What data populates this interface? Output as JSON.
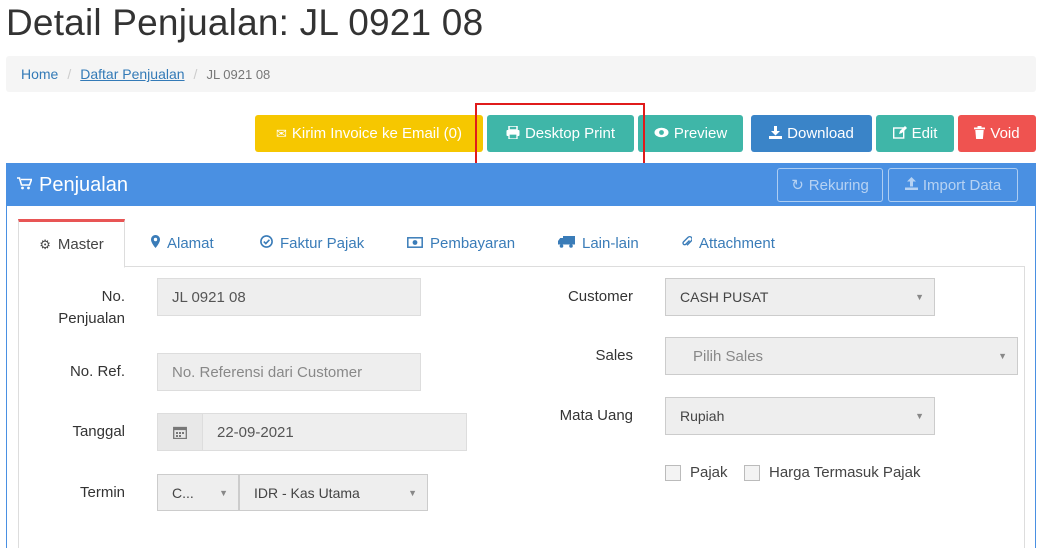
{
  "page": {
    "title": "Detail Penjualan: JL 0921 08"
  },
  "breadcrumb": {
    "home": "Home",
    "list": "Daftar Penjualan",
    "current": "JL 0921 08",
    "separator": "/"
  },
  "actions": {
    "email": "Kirim Invoice ke Email (0)",
    "print": "Desktop Print",
    "preview": "Preview",
    "download": "Download",
    "edit": "Edit",
    "void": "Void"
  },
  "panel": {
    "title": "Penjualan",
    "rekuring": "Rekuring",
    "import": "Import Data"
  },
  "tabs": [
    {
      "label": "Master",
      "icon": "gears-icon"
    },
    {
      "label": "Alamat",
      "icon": "map-marker-icon"
    },
    {
      "label": "Faktur Pajak",
      "icon": "check-circle-icon"
    },
    {
      "label": "Pembayaran",
      "icon": "money-icon"
    },
    {
      "label": "Lain-lain",
      "icon": "truck-icon"
    },
    {
      "label": "Attachment",
      "icon": "paperclip-icon"
    }
  ],
  "form": {
    "no_penjualan_label_1": "No.",
    "no_penjualan_label_2": "Penjualan",
    "no_penjualan_value": "JL 0921 08",
    "no_ref_label": "No. Ref.",
    "no_ref_placeholder": "No. Referensi dari Customer",
    "tanggal_label": "Tanggal",
    "tanggal_value": "22-09-2021",
    "termin_label": "Termin",
    "termin_value": "C...",
    "kas_value": "IDR - Kas Utama",
    "customer_label": "Customer",
    "customer_value": "CASH PUSAT",
    "sales_label": "Sales",
    "sales_placeholder": "Pilih Sales",
    "mata_uang_label": "Mata Uang",
    "mata_uang_value": "Rupiah",
    "pajak_label": "Pajak",
    "harga_termasuk_pajak_label": "Harga Termasuk Pajak"
  }
}
